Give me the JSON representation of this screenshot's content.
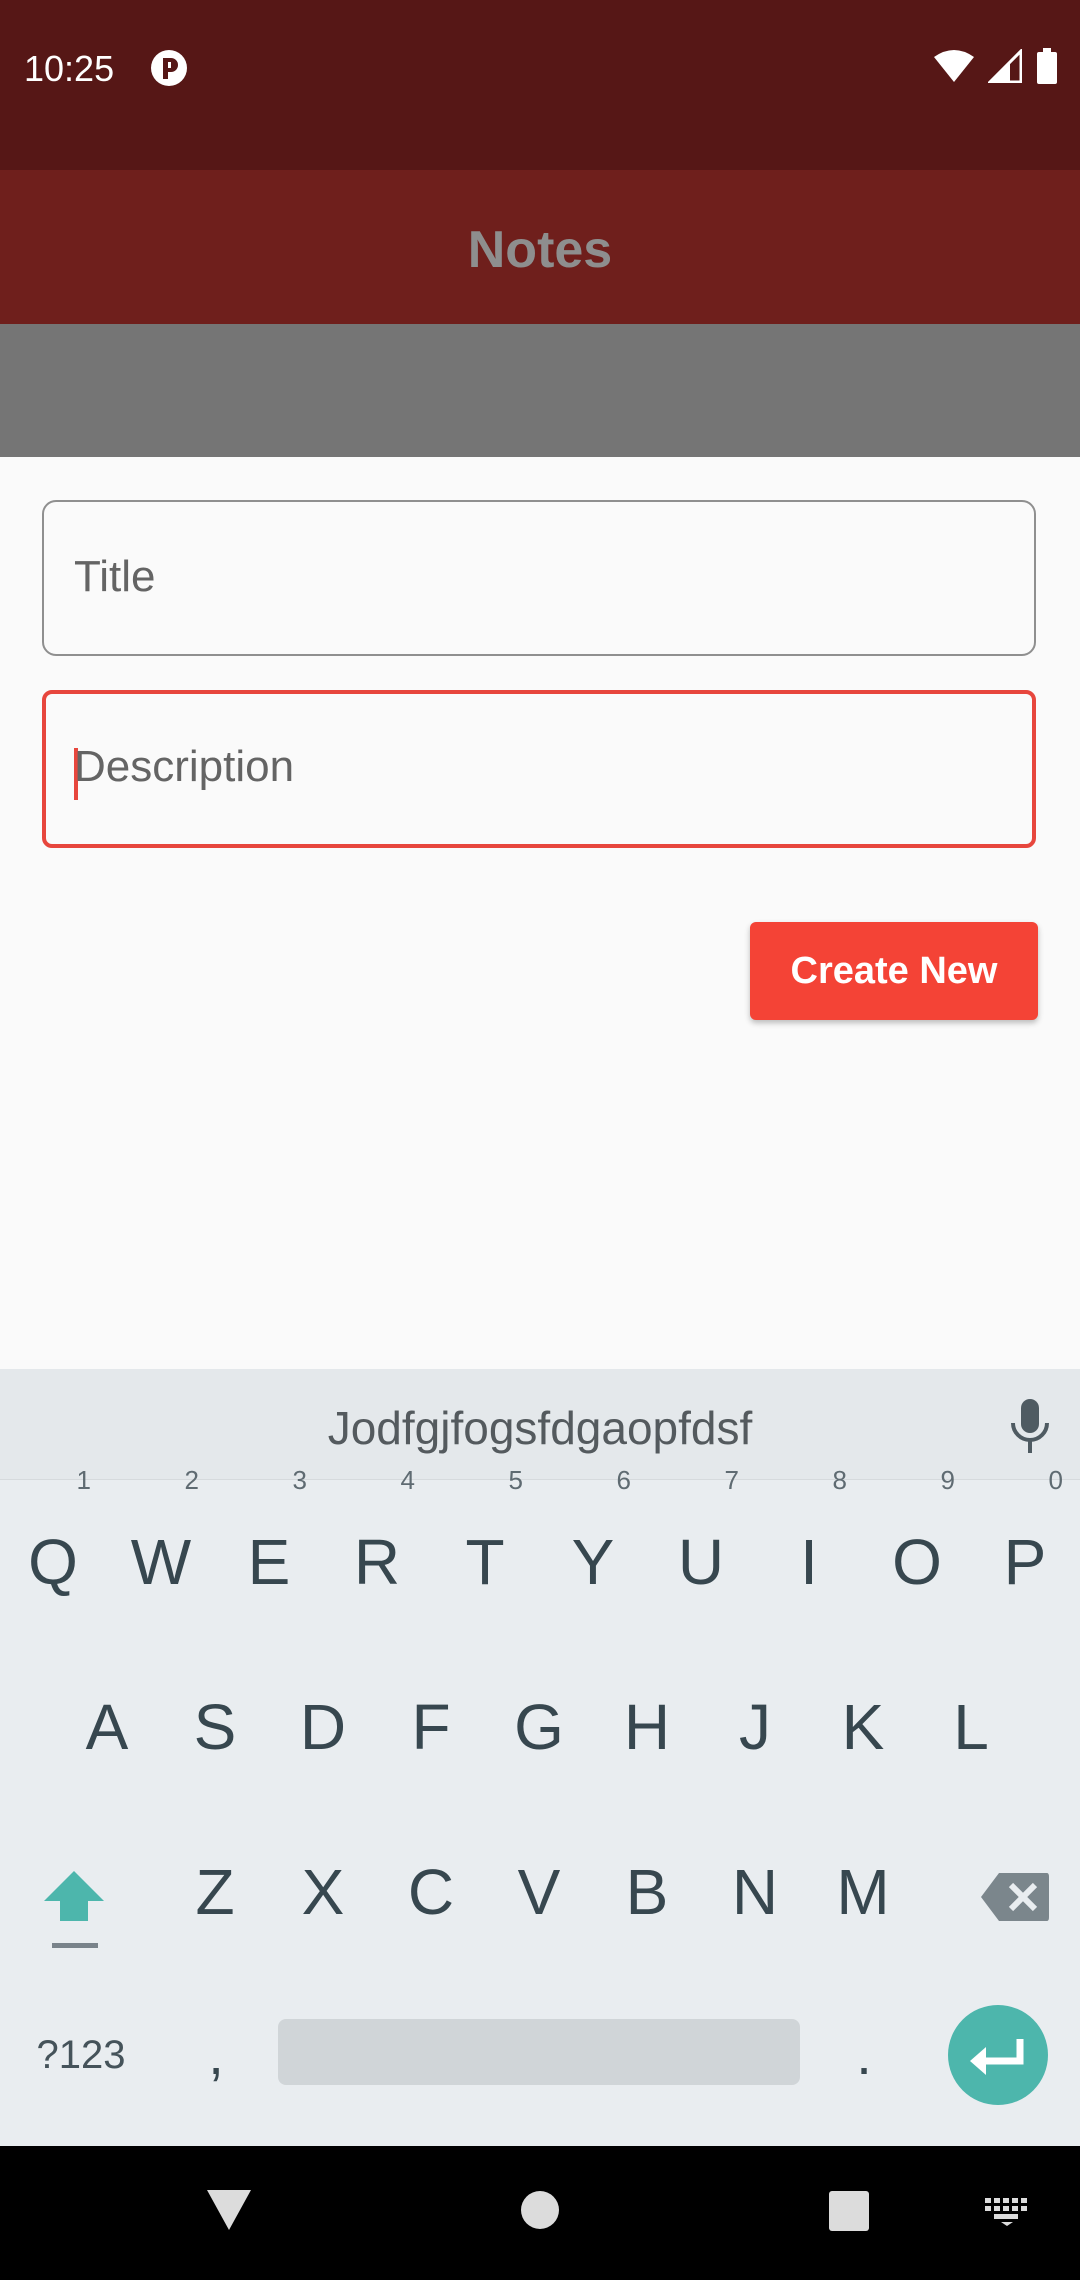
{
  "status_bar": {
    "time": "10:25"
  },
  "app_bar": {
    "title": "Notes"
  },
  "form": {
    "title_placeholder": "Title",
    "description_placeholder": "Description",
    "create_button": "Create New"
  },
  "keyboard": {
    "suggestion": "Jodfgjfogsfdgaopfdsf",
    "row1": [
      {
        "key": "Q",
        "hint": "1"
      },
      {
        "key": "W",
        "hint": "2"
      },
      {
        "key": "E",
        "hint": "3"
      },
      {
        "key": "R",
        "hint": "4"
      },
      {
        "key": "T",
        "hint": "5"
      },
      {
        "key": "Y",
        "hint": "6"
      },
      {
        "key": "U",
        "hint": "7"
      },
      {
        "key": "I",
        "hint": "8"
      },
      {
        "key": "O",
        "hint": "9"
      },
      {
        "key": "P",
        "hint": "0"
      }
    ],
    "row2": [
      "A",
      "S",
      "D",
      "F",
      "G",
      "H",
      "J",
      "K",
      "L"
    ],
    "row3": [
      "Z",
      "X",
      "C",
      "V",
      "B",
      "N",
      "M"
    ],
    "symbols_key": "?123",
    "comma_key": ",",
    "period_key": "."
  },
  "colors": {
    "status_bar": "#561716",
    "app_bar": "#6f1f1c",
    "accent": "#f44336",
    "enter_key": "#4db6ac"
  }
}
